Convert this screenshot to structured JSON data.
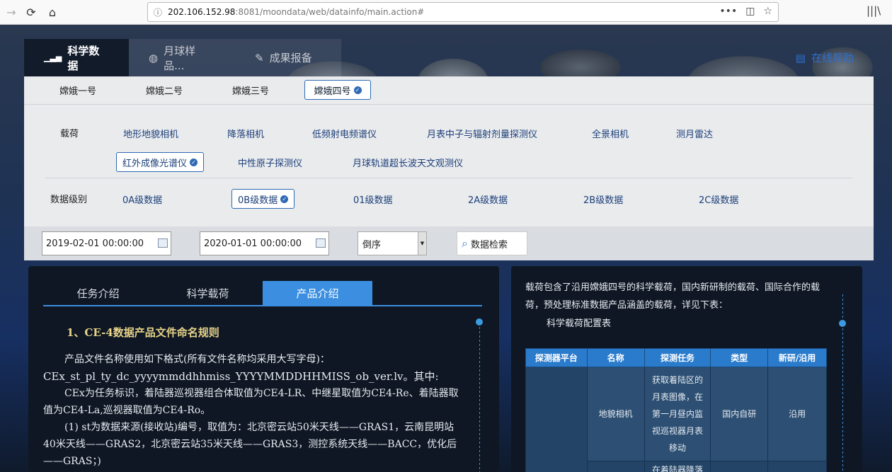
{
  "browser": {
    "url_host": "202.106.152.98",
    "url_rest": ":8081/moondata/web/datainfo/main.action#",
    "info_icon": "ⓘ"
  },
  "topnav": {
    "items": [
      {
        "label": "科学数据"
      },
      {
        "label": "月球样品..."
      },
      {
        "label": "成果报备"
      }
    ],
    "help": "在线帮助"
  },
  "missions": [
    "嫦娥一号",
    "嫦娥二号",
    "嫦娥三号",
    "嫦娥四号"
  ],
  "payload": {
    "label": "载荷",
    "options": [
      "地形地貌相机",
      "降落相机",
      "低频射电频谱仪",
      "月表中子与辐射剂量探测仪",
      "全景相机",
      "测月雷达",
      "红外成像光谱仪",
      "中性原子探测仪",
      "月球轨道超长波天文观测仪"
    ]
  },
  "level": {
    "label": "数据级别",
    "options": [
      "0A级数据",
      "0B级数据",
      "01级数据",
      "2A级数据",
      "2B级数据",
      "2C级数据"
    ]
  },
  "filters": {
    "start": "2019-02-01 00:00:00",
    "end": "2020-01-01 00:00:00",
    "order": "倒序",
    "search": "数据检索"
  },
  "intro": {
    "tabs": [
      "任务介绍",
      "科学载荷",
      "产品介绍"
    ],
    "heading": "1、CE-4数据产品文件命名规则",
    "p1": "产品文件名称使用如下格式(所有文件名称均采用大写字母)：",
    "p2": "CEx_st_pl_ty_dc_yyyymmddhhmiss_YYYYMMDDHHMISS_ob_ver.lv。其中:",
    "p3": "CEx为任务标识，着陆器巡视器组合体取值为CE4-LR、中继星取值为CE4-Re、着陆器取值为CE4-La,巡视器取值为CE4-Ro。",
    "p4": "(1) st为数据来源(接收站)编号，取值为：北京密云站50米天线——GRAS1，云南昆明站40米天线——GRAS2，北京密云站35米天线——GRAS3，测控系统天线——BACC，优化后——GRAS；)"
  },
  "payload_info": {
    "text": "载荷包含了沿用嫦娥四号的科学载荷，国内新研制的载荷、国际合作的载荷，预处理标准数据产品涵盖的载荷，详见下表：",
    "caption": "科学载荷配置表",
    "headers": [
      "探测器平台",
      "名称",
      "探测任务",
      "类型",
      "新研/沿用"
    ],
    "row1": [
      "",
      "地貌相机",
      "获取着陆区的月表图像，在第一月昼内监视巡视器月表移动",
      "国内自研",
      "沿用"
    ],
    "row2_task": "在着陆器降落"
  }
}
